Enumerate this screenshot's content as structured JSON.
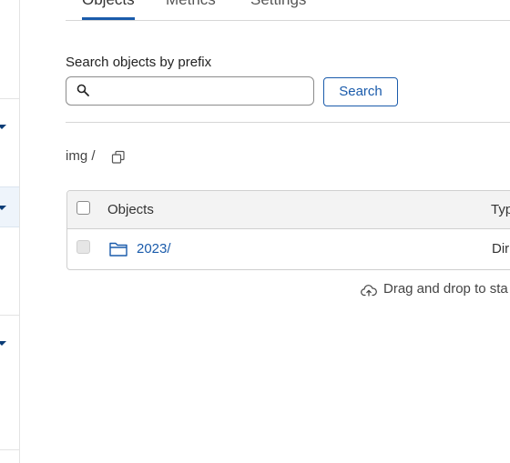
{
  "tabs": [
    {
      "label": "Objects"
    },
    {
      "label": "Metrics"
    },
    {
      "label": "Settings"
    }
  ],
  "search": {
    "label": "Search objects by prefix",
    "value": "",
    "placeholder": "",
    "button_label": "Search"
  },
  "breadcrumb": {
    "path": "img /"
  },
  "table": {
    "columns": [
      "Objects",
      "Typ"
    ],
    "rows": [
      {
        "name": "2023/",
        "type": "Dir"
      }
    ]
  },
  "dropzone": {
    "text": "Drag and drop to sta"
  },
  "colors": {
    "accent": "#1a5bab",
    "rail_active": "#eef4fb"
  },
  "icons": [
    "search-icon",
    "copy-icon",
    "folder-icon",
    "cloud-upload-icon",
    "caret-down-icon"
  ]
}
